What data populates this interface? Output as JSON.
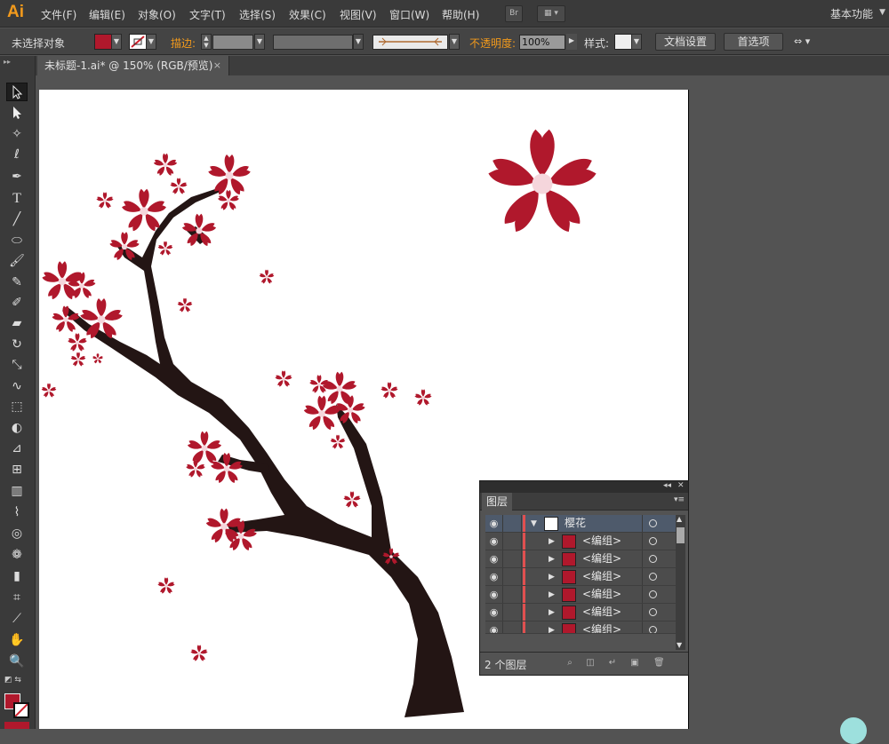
{
  "app": {
    "logo": "Ai",
    "menu": [
      "文件(F)",
      "编辑(E)",
      "对象(O)",
      "文字(T)",
      "选择(S)",
      "效果(C)",
      "视图(V)",
      "窗口(W)",
      "帮助(H)"
    ],
    "bridge_button": "Br",
    "workspace": "基本功能"
  },
  "control_bar": {
    "selection_label": "未选择对象",
    "fill_color": "#b0182c",
    "stroke_label": "描边:",
    "opacity_label": "不透明度:",
    "opacity_value": "100%",
    "style_label": "样式:",
    "doc_setup_button": "文档设置",
    "preferences_button": "首选项"
  },
  "document": {
    "tab_title": "未标题-1.ai* @ 150% (RGB/预览)",
    "close_glyph": "×"
  },
  "colors": {
    "petal": "#b0182c",
    "branch": "#231514",
    "artboard": "#ffffff",
    "accent_orange": "#f29a1c"
  },
  "layers_panel": {
    "tab": "图层",
    "rows": [
      {
        "name": "樱花",
        "expanded": true,
        "top_level": true
      },
      {
        "name": "<编组>",
        "expanded": false
      },
      {
        "name": "<编组>",
        "expanded": false
      },
      {
        "name": "<编组>",
        "expanded": false
      },
      {
        "name": "<编组>",
        "expanded": false
      },
      {
        "name": "<编组>",
        "expanded": false
      },
      {
        "name": "<编组>",
        "expanded": false
      }
    ],
    "footer": "2 个图层"
  },
  "tools": [
    "selection-tool",
    "direct-selection-tool",
    "magic-wand-tool",
    "lasso-tool",
    "pen-tool",
    "type-tool",
    "line-tool",
    "ellipse-tool",
    "paintbrush-tool",
    "pencil-tool",
    "blob-brush-tool",
    "eraser-tool",
    "rotate-tool",
    "scale-tool",
    "warp-tool",
    "free-transform-tool",
    "shape-builder-tool",
    "perspective-grid-tool",
    "mesh-tool",
    "gradient-tool",
    "eyedropper-tool",
    "blend-tool",
    "symbol-sprayer-tool",
    "column-graph-tool",
    "artboard-tool",
    "slice-tool",
    "hand-tool",
    "zoom-tool"
  ]
}
